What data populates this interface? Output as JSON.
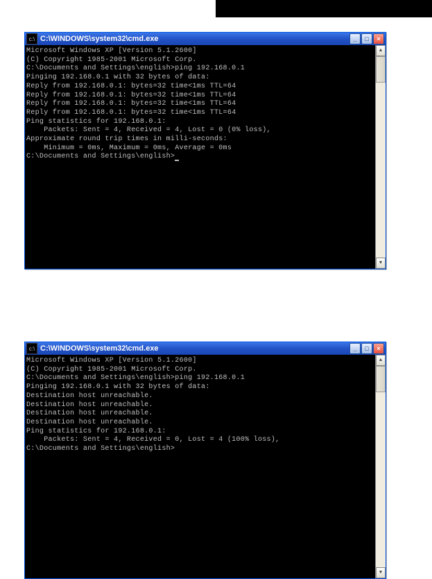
{
  "topbar": {},
  "window1": {
    "title": "C:\\WINDOWS\\system32\\cmd.exe",
    "icon_glyph": "c:\\",
    "minimize": "_",
    "maximize": "□",
    "close": "×",
    "scroll_up": "▲",
    "scroll_down": "▼",
    "lines": [
      "Microsoft Windows XP [Version 5.1.2600]",
      "(C) Copyright 1985-2001 Microsoft Corp.",
      "",
      "C:\\Documents and Settings\\english>ping 192.168.0.1",
      "",
      "Pinging 192.168.0.1 with 32 bytes of data:",
      "",
      "Reply from 192.168.0.1: bytes=32 time<1ms TTL=64",
      "Reply from 192.168.0.1: bytes=32 time<1ms TTL=64",
      "Reply from 192.168.0.1: bytes=32 time<1ms TTL=64",
      "Reply from 192.168.0.1: bytes=32 time<1ms TTL=64",
      "",
      "Ping statistics for 192.168.0.1:",
      "    Packets: Sent = 4, Received = 4, Lost = 0 (0% loss),",
      "Approximate round trip times in milli-seconds:",
      "    Minimum = 0ms, Maximum = 0ms, Average = 0ms",
      "",
      "C:\\Documents and Settings\\english>"
    ],
    "has_cursor": true
  },
  "window2": {
    "title": "C:\\WINDOWS\\system32\\cmd.exe",
    "icon_glyph": "c:\\",
    "minimize": "_",
    "maximize": "□",
    "close": "×",
    "scroll_up": "▲",
    "scroll_down": "▼",
    "lines": [
      "Microsoft Windows XP [Version 5.1.2600]",
      "(C) Copyright 1985-2001 Microsoft Corp.",
      "",
      "C:\\Documents and Settings\\english>ping 192.168.0.1",
      "",
      "Pinging 192.168.0.1 with 32 bytes of data:",
      "",
      "Destination host unreachable.",
      "Destination host unreachable.",
      "Destination host unreachable.",
      "Destination host unreachable.",
      "",
      "Ping statistics for 192.168.0.1:",
      "    Packets: Sent = 4, Received = 0, Lost = 4 (100% loss),",
      "",
      "C:\\Documents and Settings\\english>"
    ],
    "has_cursor": false
  }
}
